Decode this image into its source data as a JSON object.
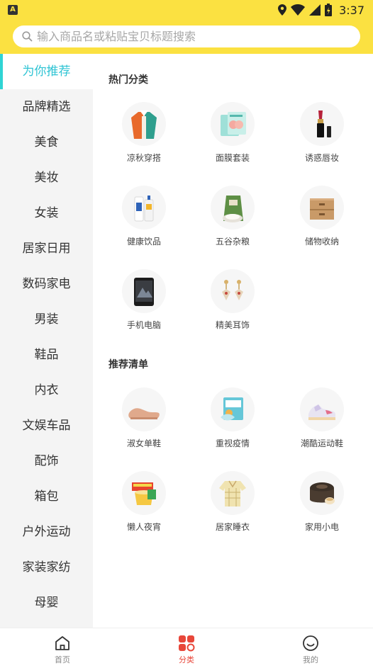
{
  "status": {
    "time": "3:37",
    "app_badge": "A"
  },
  "search": {
    "placeholder": "输入商品名或粘贴宝贝标题搜索"
  },
  "sidebar": {
    "items": [
      "为你推荐",
      "品牌精选",
      "美食",
      "美妆",
      "女装",
      "居家日用",
      "数码家电",
      "男装",
      "鞋品",
      "内衣",
      "文娱车品",
      "配饰",
      "箱包",
      "户外运动",
      "家装家纺",
      "母婴"
    ],
    "active_index": 0
  },
  "hot": {
    "title": "热门分类",
    "items": [
      {
        "label": "凉秋穿搭",
        "icon": "jacket-icon"
      },
      {
        "label": "面膜套装",
        "icon": "face-mask-icon"
      },
      {
        "label": "诱惑唇妆",
        "icon": "lipstick-icon"
      },
      {
        "label": "健康饮品",
        "icon": "drink-icon"
      },
      {
        "label": "五谷杂粮",
        "icon": "rice-bag-icon"
      },
      {
        "label": "储物收纳",
        "icon": "storage-box-icon"
      },
      {
        "label": "手机电脑",
        "icon": "phone-icon"
      },
      {
        "label": "精美耳饰",
        "icon": "earring-icon"
      }
    ]
  },
  "recommend": {
    "title": "推荐清单",
    "items": [
      {
        "label": "淑女单鞋",
        "icon": "flat-shoe-icon"
      },
      {
        "label": "重视疫情",
        "icon": "mask-box-icon"
      },
      {
        "label": "潮酷运动鞋",
        "icon": "sneaker-icon"
      },
      {
        "label": "懒人夜宵",
        "icon": "instant-food-icon"
      },
      {
        "label": "居家睡衣",
        "icon": "pajamas-icon"
      },
      {
        "label": "家用小电",
        "icon": "rice-cooker-icon"
      }
    ]
  },
  "tabbar": {
    "tabs": [
      {
        "label": "首页",
        "icon": "home-icon"
      },
      {
        "label": "分类",
        "icon": "category-icon"
      },
      {
        "label": "我的",
        "icon": "profile-icon"
      }
    ],
    "active_index": 1
  },
  "colors": {
    "header": "#fbe141",
    "active_side": "#2fc4d4",
    "active_tab": "#e8473a"
  }
}
